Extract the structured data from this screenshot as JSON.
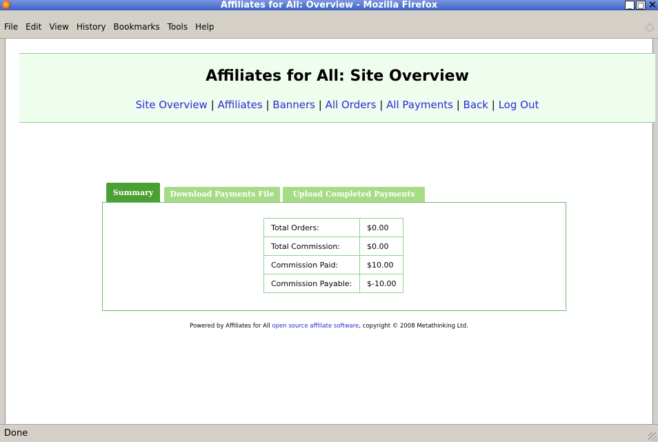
{
  "window": {
    "title": "Affiliates for All: Overview - Mozilla Firefox"
  },
  "menu": [
    "File",
    "Edit",
    "View",
    "History",
    "Bookmarks",
    "Tools",
    "Help"
  ],
  "page": {
    "heading": "Affiliates for All: Site Overview",
    "nav": [
      "Site Overview",
      "Affiliates",
      "Banners",
      "All Orders",
      "All Payments",
      "Back",
      "Log Out"
    ],
    "nav_separator": "|"
  },
  "tabs": [
    {
      "label": "Summary",
      "active": true
    },
    {
      "label": "Download Payments File",
      "active": false
    },
    {
      "label": "Upload Completed Payments",
      "active": false
    }
  ],
  "summary": [
    {
      "label": "Total Orders:",
      "value": "$0.00"
    },
    {
      "label": "Total Commission:",
      "value": "$0.00"
    },
    {
      "label": "Commission Paid:",
      "value": "$10.00"
    },
    {
      "label": "Commission Payable:",
      "value": "$-10.00"
    }
  ],
  "footer": {
    "prefix": "Powered by Affiliates for All ",
    "link": "open source affiliate software",
    "suffix": ", copyright © 2008 Metathinking Ltd."
  },
  "status": {
    "text": "Done"
  },
  "colors": {
    "tab_active": "#4aa033",
    "tab_inactive": "#a6dc86",
    "header_bg": "#eefdee",
    "link": "#2a2ad6"
  }
}
